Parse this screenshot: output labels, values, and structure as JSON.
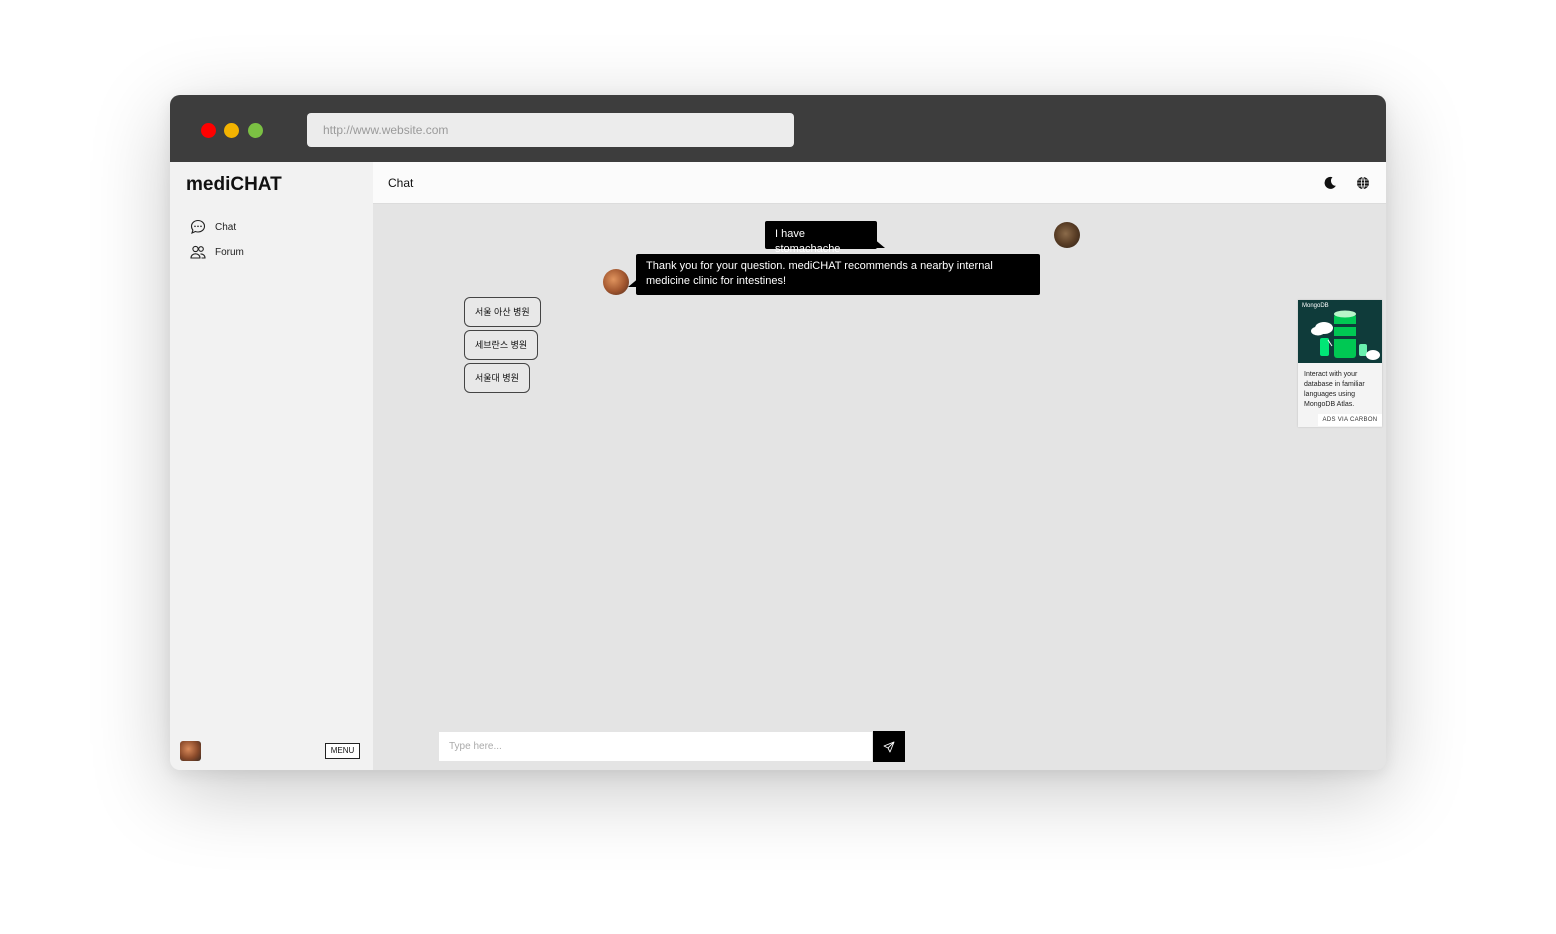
{
  "browser": {
    "url": "http://www.website.com"
  },
  "sidebar": {
    "brand": "mediCHAT",
    "items": [
      {
        "label": "Chat",
        "icon": "chat-bubble-icon"
      },
      {
        "label": "Forum",
        "icon": "people-icon"
      }
    ],
    "menu_label": "MENU"
  },
  "header": {
    "title": "Chat",
    "icons": [
      "moon-icon",
      "globe-icon"
    ]
  },
  "messages": [
    {
      "from": "user",
      "text": "I have stomachache"
    },
    {
      "from": "bot",
      "text": "Thank you for your question. mediCHAT recommends a nearby internal medicine clinic for intestines!"
    }
  ],
  "choices": [
    "서울 아산 병원",
    "세브란스 병원",
    "서울대 병원"
  ],
  "composer": {
    "placeholder": "Type here...",
    "send_icon": "paper-plane-icon"
  },
  "ad": {
    "brand": "MongoDB",
    "text": "Interact with your database in familiar languages using MongoDB Atlas.",
    "tag": "ADS VIA CARBON"
  },
  "colors": {
    "chat_bubble": "#000000",
    "titlebar": "#3d3d3d",
    "close": "#ff0000",
    "minimize": "#f3b301",
    "maximize": "#7bc043"
  }
}
